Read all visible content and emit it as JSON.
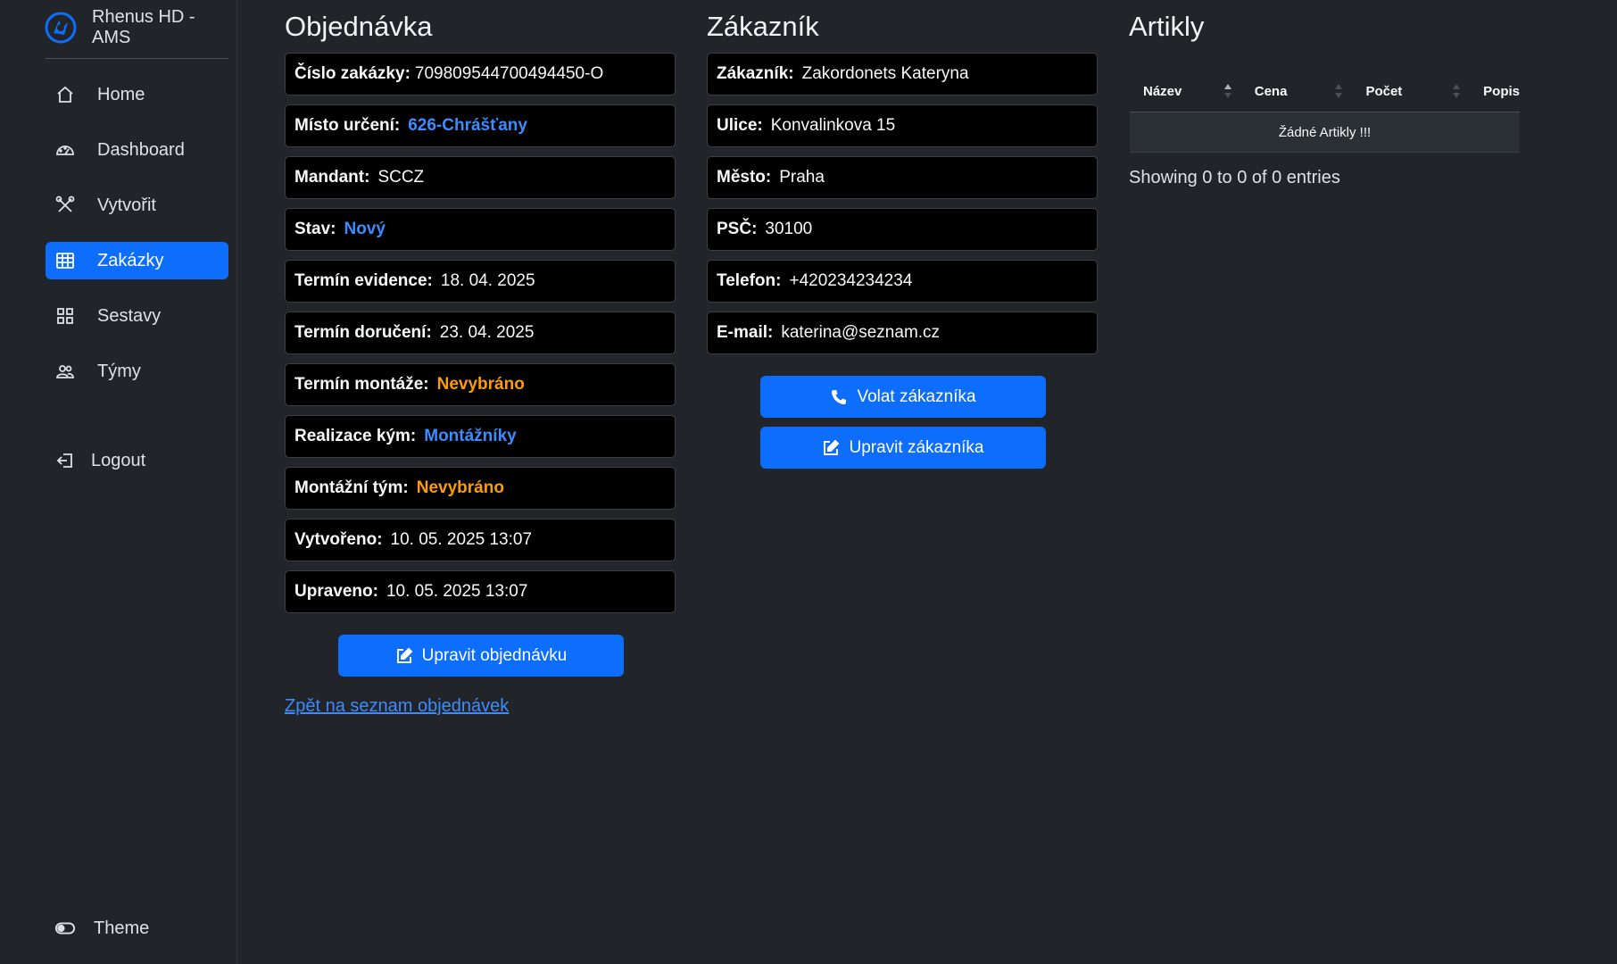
{
  "app": {
    "brand_name": "Rhenus HD - AMS"
  },
  "sidebar": {
    "items": [
      {
        "label": "Home",
        "icon": "home-icon",
        "active": false
      },
      {
        "label": "Dashboard",
        "icon": "speedometer-icon",
        "active": false
      },
      {
        "label": "Vytvořit",
        "icon": "tools-icon",
        "active": false
      },
      {
        "label": "Zakázky",
        "icon": "table-icon",
        "active": true
      },
      {
        "label": "Sestavy",
        "icon": "grid-icon",
        "active": false
      },
      {
        "label": "Týmy",
        "icon": "people-icon",
        "active": false
      }
    ],
    "logout": "Logout",
    "theme": "Theme"
  },
  "order": {
    "title": "Objednávka",
    "fields": [
      {
        "label": "Číslo zakázky:",
        "value": "709809544700494450-O"
      },
      {
        "label": "Místo určení:",
        "value": "626-Chrášťany"
      },
      {
        "label": "Mandant:",
        "value": "SCCZ"
      },
      {
        "label": "Stav:",
        "value": "Nový"
      },
      {
        "label": "Termín evidence:",
        "value": "18. 04. 2025"
      },
      {
        "label": "Termín doručení:",
        "value": "23. 04. 2025"
      },
      {
        "label": "Termín montáže:",
        "value": "Nevybráno"
      },
      {
        "label": "Realizace kým:",
        "value": "Montážníky"
      },
      {
        "label": "Montážní tým:",
        "value": "Nevybráno"
      },
      {
        "label": "Vytvořeno:",
        "value": "10. 05. 2025 13:07"
      },
      {
        "label": "Upraveno:",
        "value": "10. 05. 2025 13:07"
      }
    ],
    "edit_button": "Upravit objednávku",
    "back_link": "Zpět na seznam objednávek"
  },
  "customer": {
    "title": "Zákazník",
    "fields": [
      {
        "label": "Zákazník:",
        "value": "Zakordonets Kateryna"
      },
      {
        "label": "Ulice:",
        "value": "Konvalinkova 15"
      },
      {
        "label": "Město:",
        "value": "Praha"
      },
      {
        "label": "PSČ:",
        "value": "30100"
      },
      {
        "label": "Telefon:",
        "value": "+420234234234"
      },
      {
        "label": "E-mail:",
        "value": "katerina@seznam.cz"
      }
    ],
    "call_button": "Volat zákazníka",
    "edit_button": "Upravit zákazníka"
  },
  "articles": {
    "title": "Artikly",
    "columns": [
      "Název",
      "Cena",
      "Počet",
      "Popis"
    ],
    "empty_text": "Žádné Artikly !!!",
    "showing": "Showing 0 to 0 of 0 entries"
  },
  "colors": {
    "accent": "#0d6efd",
    "link_blue": "#3d8bfd",
    "warning_orange": "#fd9c0a",
    "background": "#212529",
    "field_bg": "#000000"
  }
}
